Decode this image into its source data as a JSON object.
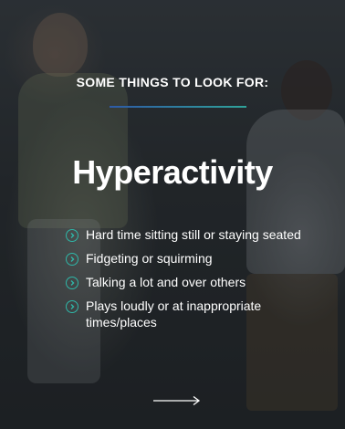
{
  "card": {
    "kicker": "SOME THINGS TO LOOK FOR:",
    "title": "Hyperactivity",
    "items": [
      "Hard time sitting still or staying seated",
      "Fidgeting or squirming",
      "Talking a lot and over others",
      "Plays loudly or at inappropriate times/places"
    ],
    "next_icon": "arrow-right-icon",
    "bullet_icon": "circle-chevron-right-icon"
  },
  "colors": {
    "accent_teal": "#2fb7a8",
    "accent_blue": "#2e5aa6",
    "text": "#ffffff"
  }
}
